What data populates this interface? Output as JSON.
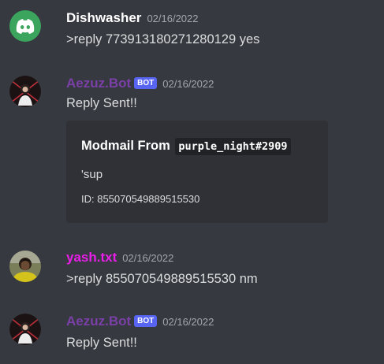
{
  "messages": [
    {
      "username": "Dishwasher",
      "username_color": "#ffffff",
      "timestamp": "02/16/2022",
      "text": ">reply 773913180271280129 yes",
      "avatar": "discord-logo-icon"
    },
    {
      "username": "Aezuz.Bot",
      "username_color": "#7b3fa8",
      "badge": "BOT",
      "timestamp": "02/16/2022",
      "text": "Reply Sent!!",
      "avatar": "bot-avatar-icon",
      "embed": {
        "title": "Modmail From",
        "title_code": "purple_night#2909",
        "description": "'sup",
        "footer": "ID: 855070549889515530"
      }
    },
    {
      "username": "yash.txt",
      "username_color": "#e91ee9",
      "timestamp": "02/16/2022",
      "text": ">reply 855070549889515530 nm",
      "avatar": "user-photo-avatar"
    },
    {
      "username": "Aezuz.Bot",
      "username_color": "#7b3fa8",
      "badge": "BOT",
      "timestamp": "02/16/2022",
      "text": "Reply Sent!!",
      "avatar": "bot-avatar-icon"
    }
  ],
  "colors": {
    "background": "#36393f",
    "embed_background": "#2f3136",
    "badge": "#5865f2",
    "discord_green": "#3ba55d"
  }
}
